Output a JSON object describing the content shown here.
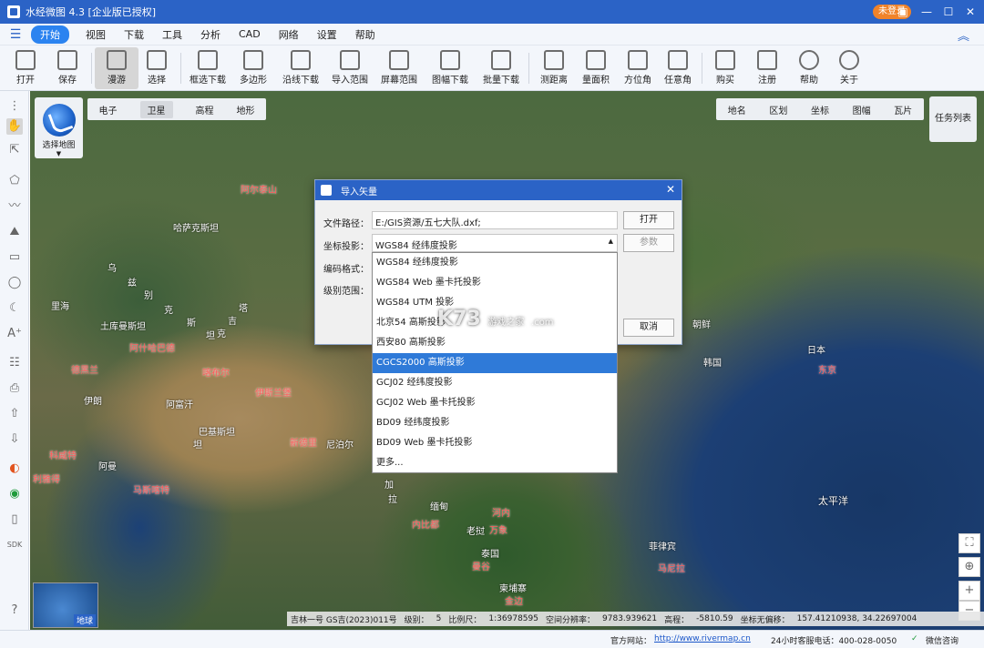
{
  "app": {
    "title": "水经微图 4.3 [企业版已授权]",
    "login_badge": "未登录"
  },
  "menu": {
    "items": [
      "开始",
      "视图",
      "下载",
      "工具",
      "分析",
      "CAD",
      "网络",
      "设置",
      "帮助"
    ]
  },
  "toolbar": {
    "items": [
      "打开",
      "保存",
      "漫游",
      "选择",
      "框选下载",
      "多边形",
      "沿线下载",
      "导入范围",
      "屏幕范围",
      "图幅下载",
      "批量下载",
      "测距离",
      "量面积",
      "方位角",
      "任意角",
      "购买",
      "注册",
      "帮助",
      "关于"
    ]
  },
  "map": {
    "tabs_left": [
      "电子",
      "卫星",
      "高程",
      "地形"
    ],
    "active_tab": "卫星",
    "tabs_right": [
      "地名",
      "区划",
      "坐标",
      "图幅",
      "瓦片"
    ],
    "task_list": "任务列表",
    "select_map": "选择地图",
    "minimap_label": "地球",
    "labels": {
      "l1": "阿尔泰山",
      "l2": "哈萨克斯坦",
      "l3": "乌",
      "l4": "兹",
      "l5": "别",
      "l6": "克",
      "l7": "斯",
      "l8": "坦",
      "l9": "土库曼斯坦",
      "l10": "阿什哈巴德",
      "l11": "塔",
      "l12": "吉",
      "l13": "克",
      "l14": "德黑兰",
      "l15": "伊朗",
      "l16": "阿富汗",
      "l17": "喀布尔",
      "l18": "伊斯兰堡",
      "l19": "巴基斯坦",
      "l20": "新德里",
      "l21": "尼泊尔",
      "l22": "科威特",
      "l23": "利雅得",
      "l24": "马斯喀特",
      "l25": "阿曼",
      "l26": "里海",
      "l27": "加",
      "l28": "拉",
      "l29": "缅甸",
      "l30": "内比都",
      "l31": "河内",
      "l32": "老挝",
      "l33": "万象",
      "l34": "泰国",
      "l35": "曼谷",
      "l36": "柬埔寨",
      "l37": "金边",
      "l38": "朝鲜",
      "l39": "日本",
      "l40": "韩国",
      "l41": "东京",
      "l42": "太平洋",
      "l43": "菲律宾",
      "l44": "马尼拉",
      "l45": "缅",
      "l46": "坦"
    }
  },
  "status": {
    "provider": "吉林一号 GS吉(2023)011号",
    "level_label": "级别：",
    "level": "5",
    "scale_label": "比例尺：",
    "scale": "1:36978595",
    "resolution_label": "空间分辨率：",
    "resolution": "9783.939621",
    "elevation_label": "高程：",
    "elevation": "-5810.59",
    "coords_label": "坐标无偏移：",
    "coords": "157.41210938, 34.22697004"
  },
  "footer": {
    "site_label": "官方网站：",
    "site_url": "http://www.rivermap.cn",
    "hotline_label": "24小时客服电话：400-028-0050",
    "wechat": "微信咨询"
  },
  "dialog": {
    "title": "导入矢量",
    "file_path_label": "文件路径：",
    "file_path": "E:/GIS资源/五七大队.dxf;",
    "open_button": "打开",
    "projection_label": "坐标投影：",
    "projection_value": "WGS84 经纬度投影",
    "params_button": "参数",
    "encoding_label": "编码格式：",
    "level_range_label": "级别范围：",
    "cancel_button": "取消",
    "options": [
      "WGS84 经纬度投影",
      "WGS84 Web 墨卡托投影",
      "WGS84 UTM 投影",
      "北京54 高斯投影",
      "西安80 高斯投影",
      "CGCS2000 高斯投影",
      "GCJ02 经纬度投影",
      "GCJ02 Web 墨卡托投影",
      "BD09 经纬度投影",
      "BD09 Web 墨卡托投影",
      "更多..."
    ],
    "highlighted_index": 5
  },
  "watermark": {
    "main": "K73",
    "sub1": "游戏之家",
    "sub2": ".com"
  }
}
